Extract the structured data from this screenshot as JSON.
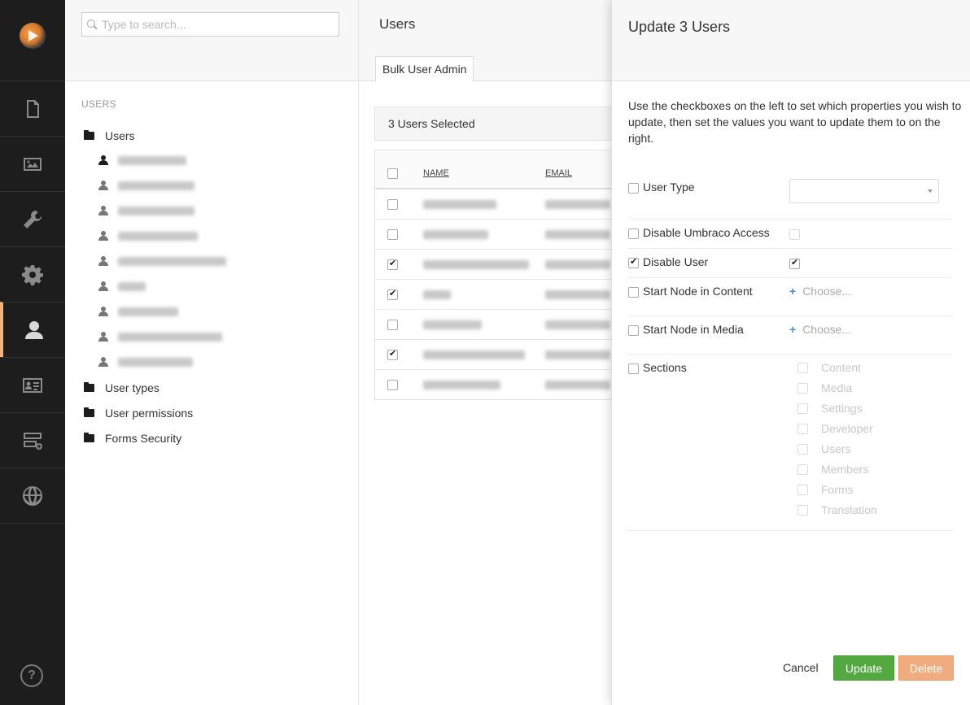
{
  "appbar": {
    "logo": "umbraco-logo",
    "sections": [
      {
        "name": "content",
        "icon": "document-icon",
        "active": false
      },
      {
        "name": "media",
        "icon": "image-icon",
        "active": false
      },
      {
        "name": "settings",
        "icon": "wrench-icon",
        "active": false
      },
      {
        "name": "developer",
        "icon": "gear-icon",
        "active": false
      },
      {
        "name": "users",
        "icon": "user-icon",
        "active": true
      },
      {
        "name": "members",
        "icon": "id-card-icon",
        "active": false
      },
      {
        "name": "forms",
        "icon": "forms-icon",
        "active": false
      },
      {
        "name": "translation",
        "icon": "globe-icon",
        "active": false
      }
    ],
    "help_label": "?",
    "active_color": "#f5b37b"
  },
  "tree": {
    "search_placeholder": "Type to search...",
    "section_label": "USERS",
    "root": "Users",
    "folders": [
      "User types",
      "User permissions",
      "Forms Security"
    ]
  },
  "main": {
    "title": "Users",
    "tab": "Bulk User Admin",
    "selected_text": "3 Users Selected",
    "columns": {
      "name": "NAME",
      "email": "EMAIL"
    },
    "rows": [
      {
        "checked": false
      },
      {
        "checked": false
      },
      {
        "checked": true
      },
      {
        "checked": true
      },
      {
        "checked": false
      },
      {
        "checked": true
      },
      {
        "checked": false
      }
    ]
  },
  "dialog": {
    "title": "Update 3 Users",
    "description": "Use the checkboxes on the left to set which properties you wish to update, then set the values you want to update them to on the right.",
    "props": {
      "user_type": "User Type",
      "disable_access": "Disable Umbraco Access",
      "disable_user": "Disable User",
      "start_content": "Start Node in Content",
      "start_media": "Start Node in Media",
      "sections": "Sections"
    },
    "choose_label": "Choose...",
    "section_options": [
      "Content",
      "Media",
      "Settings",
      "Developer",
      "Users",
      "Members",
      "Forms",
      "Translation"
    ],
    "buttons": {
      "cancel": "Cancel",
      "update": "Update",
      "delete": "Delete"
    },
    "colors": {
      "update": "#53a93f",
      "delete": "#f0ac7e"
    }
  }
}
